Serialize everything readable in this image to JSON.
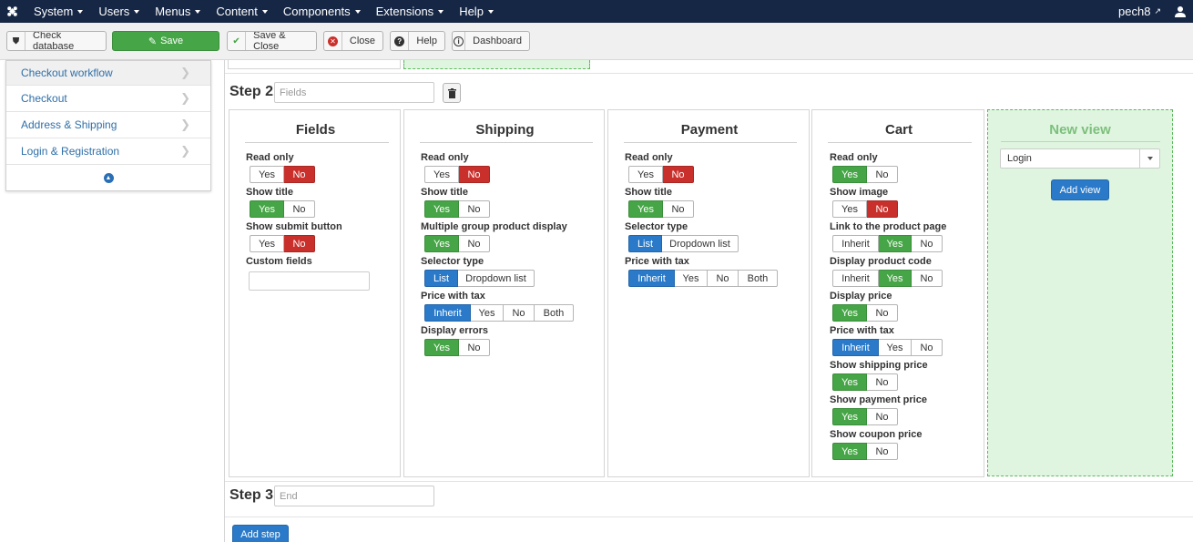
{
  "navbar": {
    "menu": [
      "System",
      "Users",
      "Menus",
      "Content",
      "Components",
      "Extensions",
      "Help"
    ],
    "user": "pech8"
  },
  "toolbar": {
    "check_database": "Check database",
    "save": "Save",
    "save_close": "Save & Close",
    "close": "Close",
    "help": "Help",
    "dashboard": "Dashboard"
  },
  "sidebar": {
    "items": [
      "Checkout workflow",
      "Checkout",
      "Address & Shipping",
      "Login & Registration"
    ]
  },
  "steps": {
    "step2_label": "Step 2",
    "step2_placeholder": "Fields",
    "step3_label": "Step 3",
    "step3_placeholder": "End"
  },
  "common": {
    "yes": "Yes",
    "no": "No",
    "inherit": "Inherit",
    "both": "Both",
    "list": "List",
    "dropdown_list": "Dropdown list"
  },
  "fields_panel": {
    "title": "Fields",
    "read_only": "Read only",
    "show_title": "Show title",
    "show_submit_button": "Show submit button",
    "custom_fields": "Custom fields"
  },
  "shipping_panel": {
    "title": "Shipping",
    "read_only": "Read only",
    "show_title": "Show title",
    "multiple_group": "Multiple group product display",
    "selector_type": "Selector type",
    "price_with_tax": "Price with tax",
    "display_errors": "Display errors"
  },
  "payment_panel": {
    "title": "Payment",
    "read_only": "Read only",
    "show_title": "Show title",
    "selector_type": "Selector type",
    "price_with_tax": "Price with tax"
  },
  "cart_panel": {
    "title": "Cart",
    "read_only": "Read only",
    "show_image": "Show image",
    "link_to_product": "Link to the product page",
    "display_product_code": "Display product code",
    "display_price": "Display price",
    "price_with_tax": "Price with tax",
    "show_shipping_price": "Show shipping price",
    "show_payment_price": "Show payment price",
    "show_coupon_price": "Show coupon price"
  },
  "new_view": {
    "title": "New view",
    "selected": "Login",
    "add_view": "Add view"
  },
  "add_step": "Add step",
  "colors": {
    "navbar": "#162745",
    "green": "#46a546",
    "red": "#c9302c",
    "blue": "#2a7ac9",
    "link": "#2f6fa8",
    "dropzone": "#dff5df"
  }
}
